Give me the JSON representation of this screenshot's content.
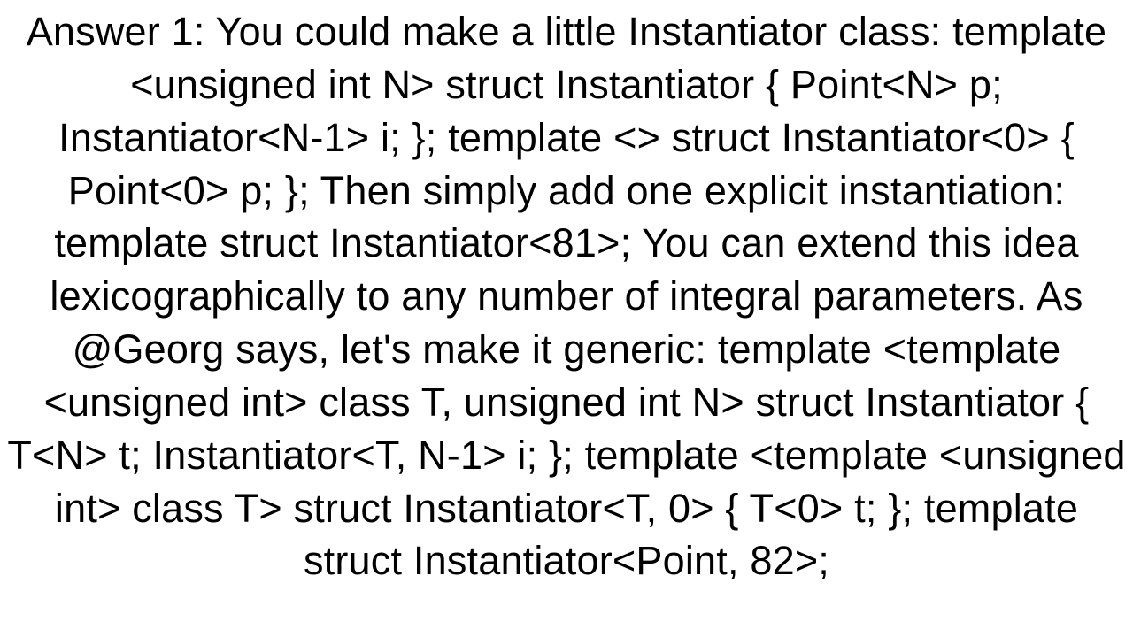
{
  "answer": {
    "heading": "Answer 1:",
    "body": "You could make a little Instantiator class: template <unsigned int N> struct Instantiator {   Point<N> p;   Instantiator<N-1> i; };  template <> struct Instantiator<0> {   Point<0> p; };  Then simply add one explicit instantiation: template struct Instantiator<81>; You can extend this idea lexicographically to any number of integral parameters.  As @Georg says, let's make it generic: template <template <unsigned int> class T, unsigned int N> struct Instantiator {   T<N> t;   Instantiator<T, N-1> i; };  template <template <unsigned int> class T> struct Instantiator<T, 0> {   T<0> t; };  template struct Instantiator<Point, 82>;"
  }
}
